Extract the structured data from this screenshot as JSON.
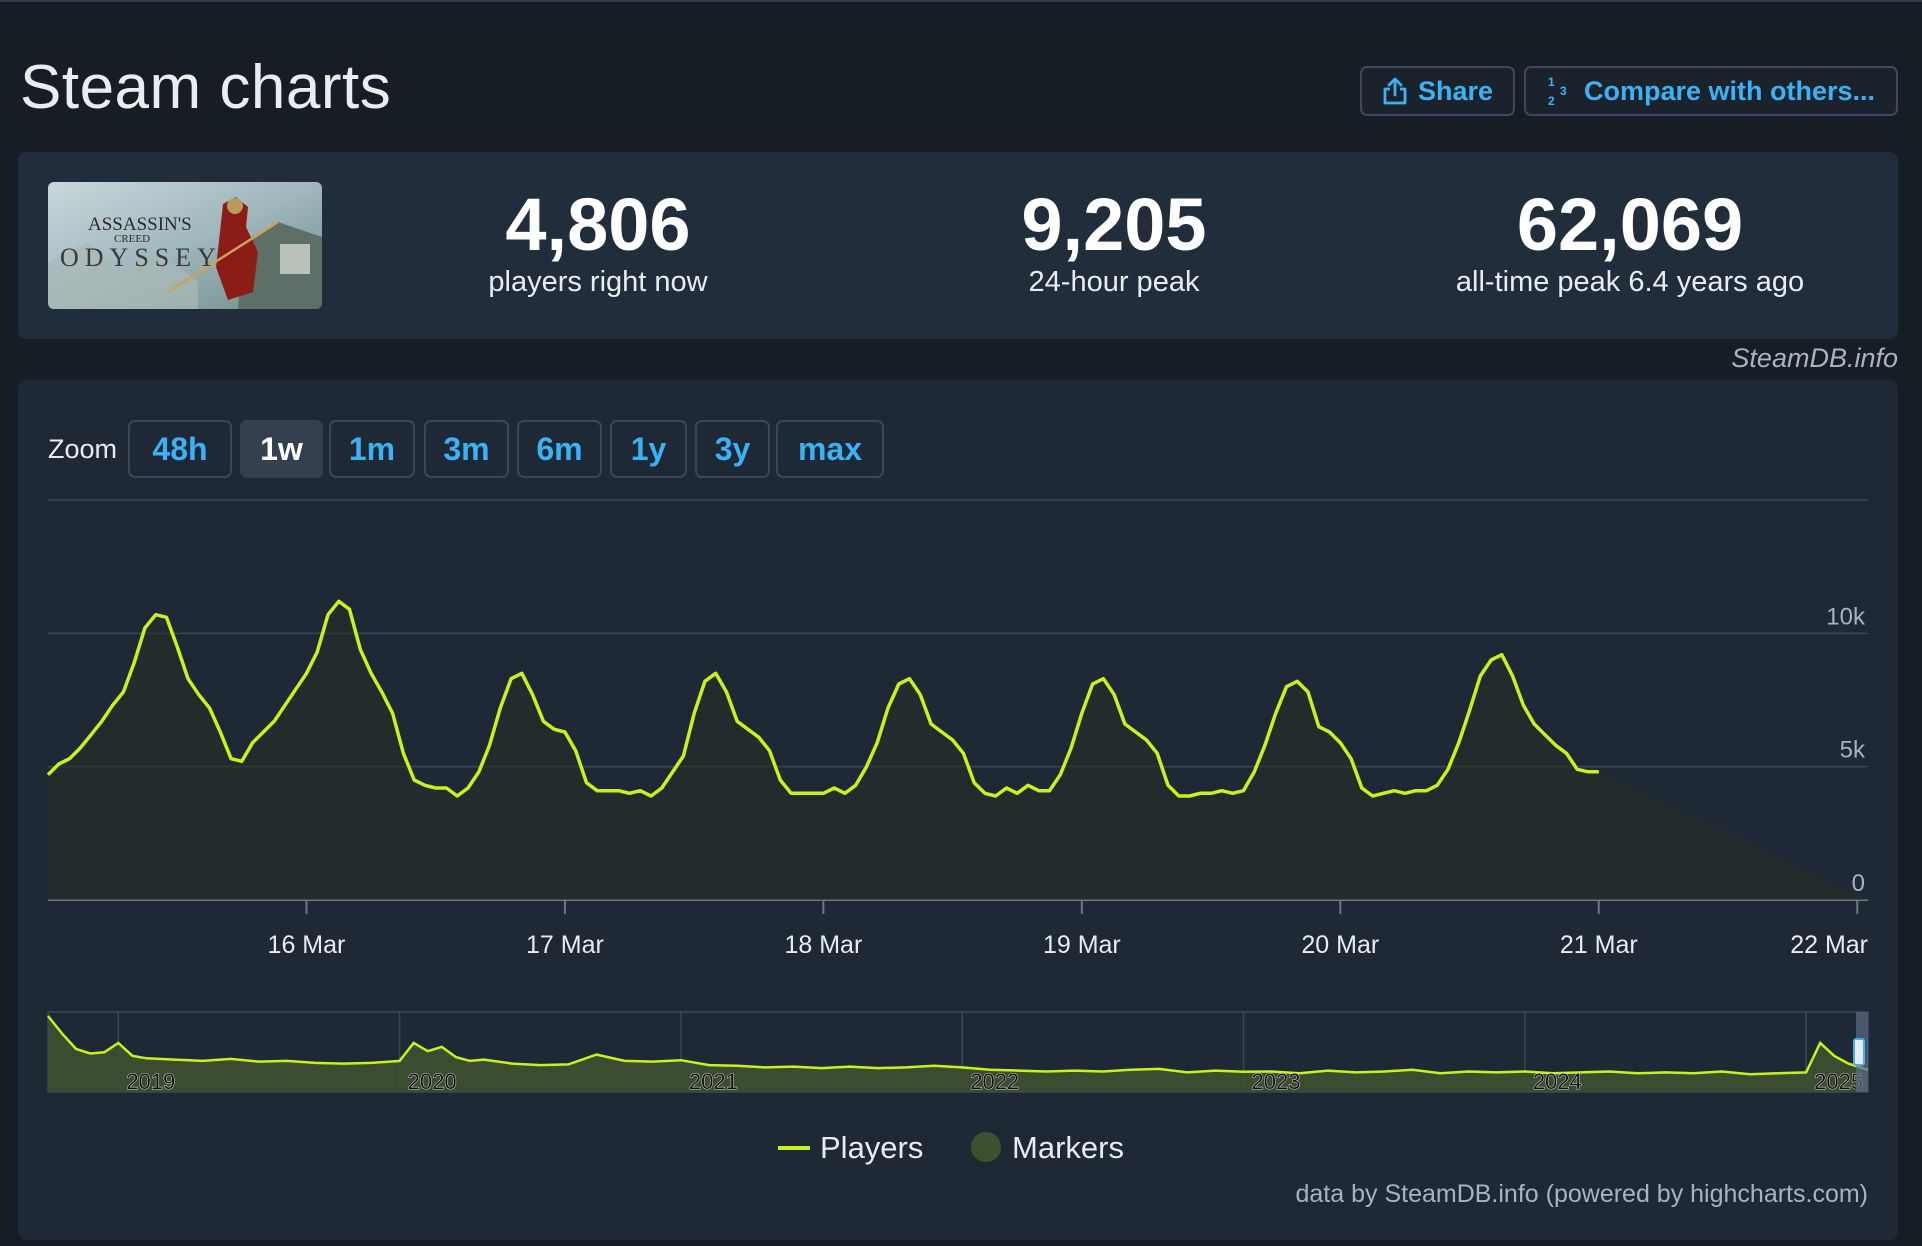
{
  "header": {
    "title": "Steam charts",
    "share_label": "Share",
    "compare_label": "Compare with others..."
  },
  "game": {
    "thumbnail_line1": "ASSASSIN'S",
    "thumbnail_line2": "CREED",
    "thumbnail_line3": "ODYSSEY"
  },
  "stats": [
    {
      "value": "4,806",
      "label": "players right now"
    },
    {
      "value": "9,205",
      "label": "24-hour peak"
    },
    {
      "value": "62,069",
      "label": "all-time peak 6.4 years ago"
    }
  ],
  "watermark": "SteamDB.info",
  "zoom": {
    "label": "Zoom",
    "options": [
      "48h",
      "1w",
      "1m",
      "3m",
      "6m",
      "1y",
      "3y",
      "max"
    ],
    "active": "1w"
  },
  "legend": {
    "players": "Players",
    "markers": "Markers"
  },
  "credit": "data by SteamDB.info (powered by highcharts.com)",
  "colors": {
    "line": "#c6f31b",
    "marker": "#3e5030",
    "accent": "#3cb2f6",
    "background": "#171d25",
    "panel": "#222d3b"
  },
  "chart_data": [
    {
      "type": "line",
      "y_ticks": [
        0,
        5000,
        10000
      ],
      "y_tick_labels": [
        "0",
        "5k",
        "10k"
      ],
      "ylim": [
        0,
        15000
      ],
      "x_range": [
        "15 Mar 00:00",
        "22 Mar 01:00"
      ],
      "x_ticks": [
        "16 Mar",
        "17 Mar",
        "18 Mar",
        "19 Mar",
        "20 Mar",
        "21 Mar",
        "22 Mar"
      ],
      "series": [
        {
          "name": "Players",
          "x_hours": [
            0,
            1,
            2,
            3,
            4,
            5,
            6,
            7,
            8,
            9,
            10,
            11,
            12,
            13,
            14,
            15,
            16,
            17,
            18,
            19,
            20,
            21,
            22,
            23,
            24,
            25,
            26,
            27,
            28,
            29,
            30,
            31,
            32,
            33,
            34,
            35,
            36,
            37,
            38,
            39,
            40,
            41,
            42,
            43,
            44,
            45,
            46,
            47,
            48,
            49,
            50,
            51,
            52,
            53,
            54,
            55,
            56,
            57,
            58,
            59,
            60,
            61,
            62,
            63,
            64,
            65,
            66,
            67,
            68,
            69,
            70,
            71,
            72,
            73,
            74,
            75,
            76,
            77,
            78,
            79,
            80,
            81,
            82,
            83,
            84,
            85,
            86,
            87,
            88,
            89,
            90,
            91,
            92,
            93,
            94,
            95,
            96,
            97,
            98,
            99,
            100,
            101,
            102,
            103,
            104,
            105,
            106,
            107,
            108,
            109,
            110,
            111,
            112,
            113,
            114,
            115,
            116,
            117,
            118,
            119,
            120,
            121,
            122,
            123,
            124,
            125,
            126,
            127,
            128,
            129,
            130,
            131,
            132,
            133,
            134,
            135,
            136,
            137,
            138,
            139,
            140,
            141,
            142,
            143,
            144,
            145,
            146,
            147,
            148,
            149,
            150,
            151,
            152,
            153,
            154,
            155,
            156,
            157,
            158,
            159,
            160,
            161,
            162,
            163,
            164,
            165,
            166,
            167,
            168,
            169
          ],
          "values": [
            4700,
            5100,
            5300,
            5700,
            6200,
            6700,
            7300,
            7800,
            8900,
            10200,
            10700,
            10600,
            9500,
            8300,
            7700,
            7200,
            6300,
            5300,
            5200,
            5900,
            6300,
            6700,
            7300,
            7900,
            8500,
            9300,
            10700,
            11200,
            10900,
            9400,
            8500,
            7800,
            7000,
            5500,
            4500,
            4300,
            4200,
            4200,
            3900,
            4200,
            4800,
            5800,
            7200,
            8300,
            8500,
            7700,
            6700,
            6400,
            6300,
            5600,
            4400,
            4100,
            4100,
            4100,
            4000,
            4100,
            3900,
            4200,
            4800,
            5400,
            7000,
            8200,
            8500,
            7800,
            6700,
            6400,
            6100,
            5600,
            4500,
            4000,
            4000,
            4000,
            4000,
            4200,
            4000,
            4300,
            5000,
            5900,
            7200,
            8100,
            8300,
            7700,
            6600,
            6300,
            6000,
            5500,
            4400,
            4000,
            3900,
            4200,
            4000,
            4300,
            4100,
            4100,
            4700,
            5700,
            7000,
            8100,
            8300,
            7700,
            6600,
            6300,
            6000,
            5500,
            4300,
            3900,
            3900,
            4000,
            4000,
            4100,
            4000,
            4100,
            4800,
            5800,
            7000,
            8000,
            8200,
            7800,
            6500,
            6300,
            5900,
            5300,
            4200,
            3900,
            4000,
            4100,
            4000,
            4100,
            4100,
            4300,
            4900,
            5900,
            7100,
            8400,
            9000,
            9200,
            8400,
            7300,
            6600,
            6200,
            5800,
            5500,
            4900,
            4806,
            4806
          ]
        }
      ]
    },
    {
      "type": "area",
      "role": "navigator",
      "x_ticks": [
        "2019",
        "2020",
        "2021",
        "2022",
        "2023",
        "2024",
        "2025"
      ],
      "series": [
        {
          "name": "Players",
          "x_years": [
            2018.75,
            2018.8,
            2018.85,
            2018.9,
            2018.95,
            2019.0,
            2019.05,
            2019.1,
            2019.2,
            2019.3,
            2019.4,
            2019.5,
            2019.6,
            2019.7,
            2019.8,
            2019.9,
            2020.0,
            2020.05,
            2020.1,
            2020.15,
            2020.2,
            2020.25,
            2020.3,
            2020.4,
            2020.5,
            2020.6,
            2020.7,
            2020.8,
            2020.9,
            2021.0,
            2021.1,
            2021.2,
            2021.3,
            2021.4,
            2021.5,
            2021.6,
            2021.7,
            2021.8,
            2021.9,
            2022.0,
            2022.1,
            2022.2,
            2022.3,
            2022.4,
            2022.5,
            2022.6,
            2022.7,
            2022.8,
            2022.9,
            2023.0,
            2023.1,
            2023.2,
            2023.3,
            2023.4,
            2023.5,
            2023.6,
            2023.7,
            2023.8,
            2023.9,
            2024.0,
            2024.1,
            2024.2,
            2024.3,
            2024.4,
            2024.5,
            2024.6,
            2024.7,
            2024.8,
            2024.9,
            2025.0,
            2025.05,
            2025.1,
            2025.15,
            2025.22
          ],
          "values": [
            62069,
            40000,
            24000,
            20000,
            21000,
            30000,
            18000,
            16000,
            15000,
            14000,
            15500,
            13500,
            14000,
            12500,
            12000,
            12500,
            14000,
            30000,
            22000,
            26000,
            17000,
            14000,
            15000,
            12000,
            11000,
            11500,
            19000,
            14000,
            13500,
            14500,
            11000,
            10500,
            9500,
            10000,
            9000,
            10000,
            9000,
            9500,
            10500,
            9500,
            8000,
            7500,
            7000,
            7500,
            7000,
            8000,
            8500,
            6500,
            7500,
            6800,
            7000,
            6000,
            7500,
            6500,
            7000,
            8000,
            6000,
            7000,
            6500,
            7000,
            6000,
            6500,
            7000,
            6000,
            6500,
            6000,
            7000,
            5500,
            6000,
            6500,
            30000,
            18000,
            12000,
            8000
          ]
        }
      ]
    }
  ]
}
